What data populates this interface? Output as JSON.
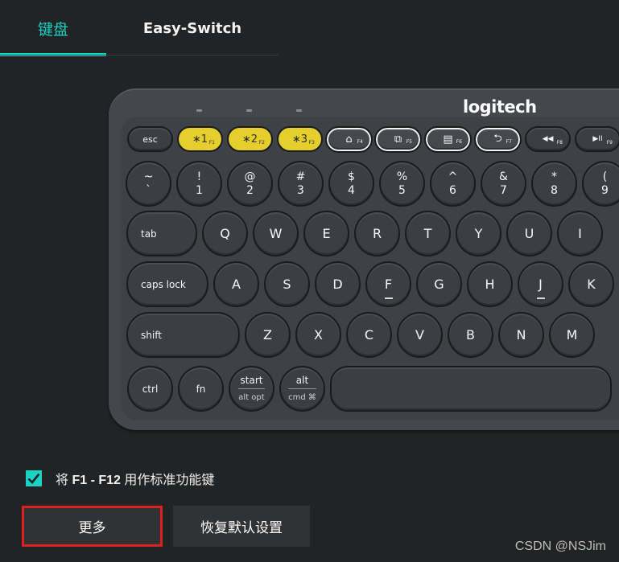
{
  "tabs": [
    {
      "label": "键盘",
      "active": true
    },
    {
      "label": "Easy-Switch",
      "active": false
    }
  ],
  "colors": {
    "accent": "#19d3c3",
    "yellow_key": "#e6cf2c",
    "highlight_border": "#e01f1f"
  },
  "keyboard": {
    "brand": "logitech",
    "row0": [
      {
        "main": "esc"
      },
      {
        "main": "∗1",
        "sub": "F1"
      },
      {
        "main": "∗2",
        "sub": "F2"
      },
      {
        "main": "∗3",
        "sub": "F3"
      },
      {
        "main": "⌂",
        "sub": "F4"
      },
      {
        "main": "⧉",
        "sub": "F5"
      },
      {
        "main": "▤",
        "sub": "F6"
      },
      {
        "main": "⮌",
        "sub": "F7"
      },
      {
        "main": "◀◀",
        "sub": "F8"
      },
      {
        "main": "▶II",
        "sub": "F9"
      }
    ],
    "row1": [
      {
        "top": "~",
        "bottom": "`"
      },
      {
        "top": "!",
        "bottom": "1"
      },
      {
        "top": "@",
        "bottom": "2"
      },
      {
        "top": "#",
        "bottom": "3"
      },
      {
        "top": "$",
        "bottom": "4"
      },
      {
        "top": "%",
        "bottom": "5"
      },
      {
        "top": "^",
        "bottom": "6"
      },
      {
        "top": "&",
        "bottom": "7"
      },
      {
        "top": "*",
        "bottom": "8"
      },
      {
        "top": "(",
        "bottom": "9"
      }
    ],
    "row2": [
      "tab",
      "Q",
      "W",
      "E",
      "R",
      "T",
      "Y",
      "U",
      "I"
    ],
    "row3": [
      "caps lock",
      "A",
      "S",
      "D",
      "F",
      "G",
      "H",
      "J",
      "K"
    ],
    "row4": [
      "shift",
      "Z",
      "X",
      "C",
      "V",
      "B",
      "N",
      "M"
    ],
    "row5": [
      {
        "main": "ctrl"
      },
      {
        "main": "fn"
      },
      {
        "main": "start",
        "sub": "alt opt"
      },
      {
        "main": "alt",
        "sub": "cmd ⌘"
      }
    ]
  },
  "fkey_option": {
    "prefix": "将 ",
    "keys": "F1 - F12",
    "suffix": " 用作标准功能键",
    "checked": true
  },
  "buttons": {
    "more": "更多",
    "reset": "恢复默认设置"
  },
  "watermark": "CSDN @NSJim"
}
